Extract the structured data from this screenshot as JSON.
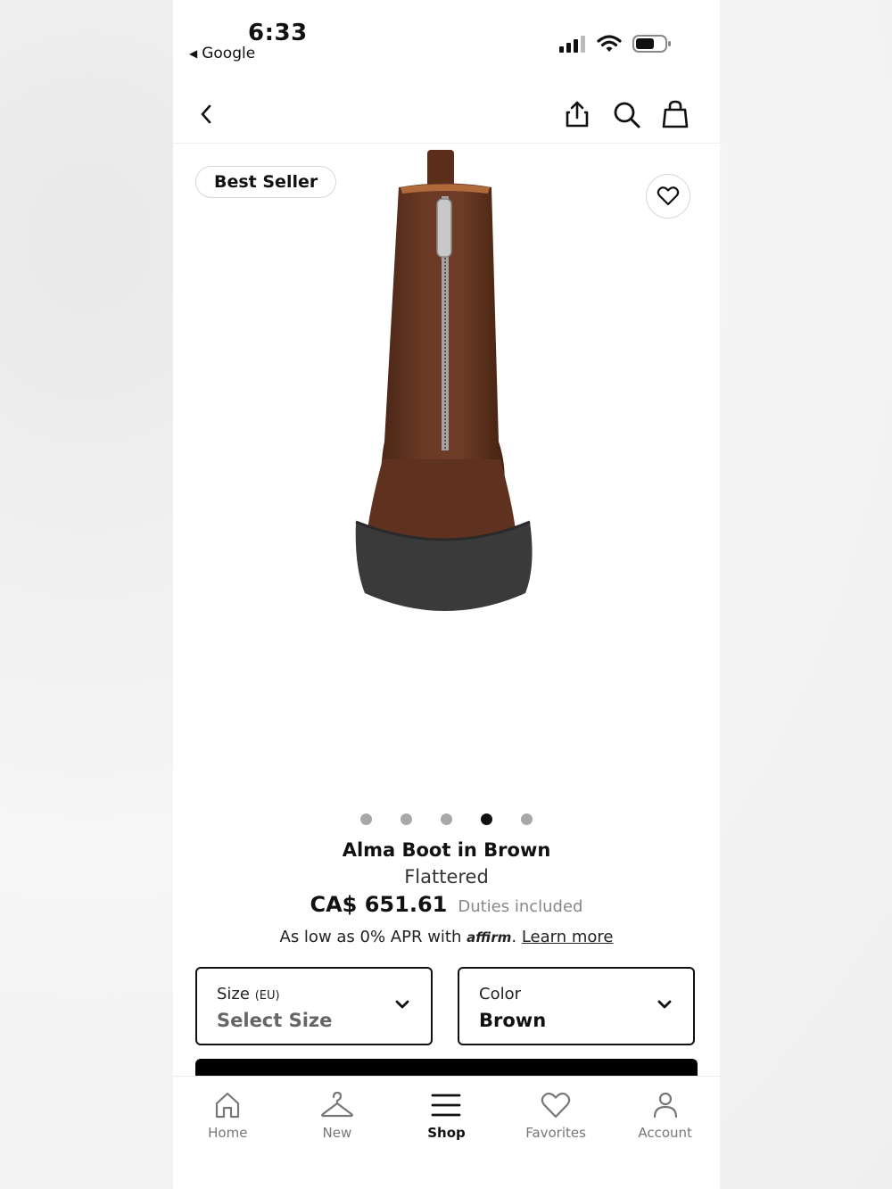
{
  "status_bar": {
    "time": "6:33",
    "back_app": "Google"
  },
  "colors": {
    "accent": "#111111",
    "muted": "#888888",
    "affirm": "#4a4af4",
    "boot": "#6b3a25"
  },
  "nav": {
    "icons": [
      "back-icon",
      "share-icon",
      "search-icon",
      "bag-icon"
    ]
  },
  "hero": {
    "badge": "Best Seller",
    "image_count": 5,
    "active_image": 4
  },
  "product": {
    "name": "Alma Boot in Brown",
    "brand": "Flattered",
    "price": "CA$ 651.61",
    "duties": "Duties included",
    "affirm_prefix": "As low as 0% APR with",
    "affirm_logo": "affirm",
    "affirm_sep": ".",
    "learn_more": "Learn more"
  },
  "size": {
    "label": "Size",
    "unit": "(EU)",
    "value": "Select Size"
  },
  "color": {
    "label": "Color",
    "value": "Brown"
  },
  "tabs": [
    {
      "label": "Home",
      "icon": "home-icon"
    },
    {
      "label": "New",
      "icon": "hanger-icon"
    },
    {
      "label": "Shop",
      "icon": "menu-icon"
    },
    {
      "label": "Favorites",
      "icon": "heart-icon"
    },
    {
      "label": "Account",
      "icon": "person-icon"
    }
  ],
  "active_tab": "Shop"
}
